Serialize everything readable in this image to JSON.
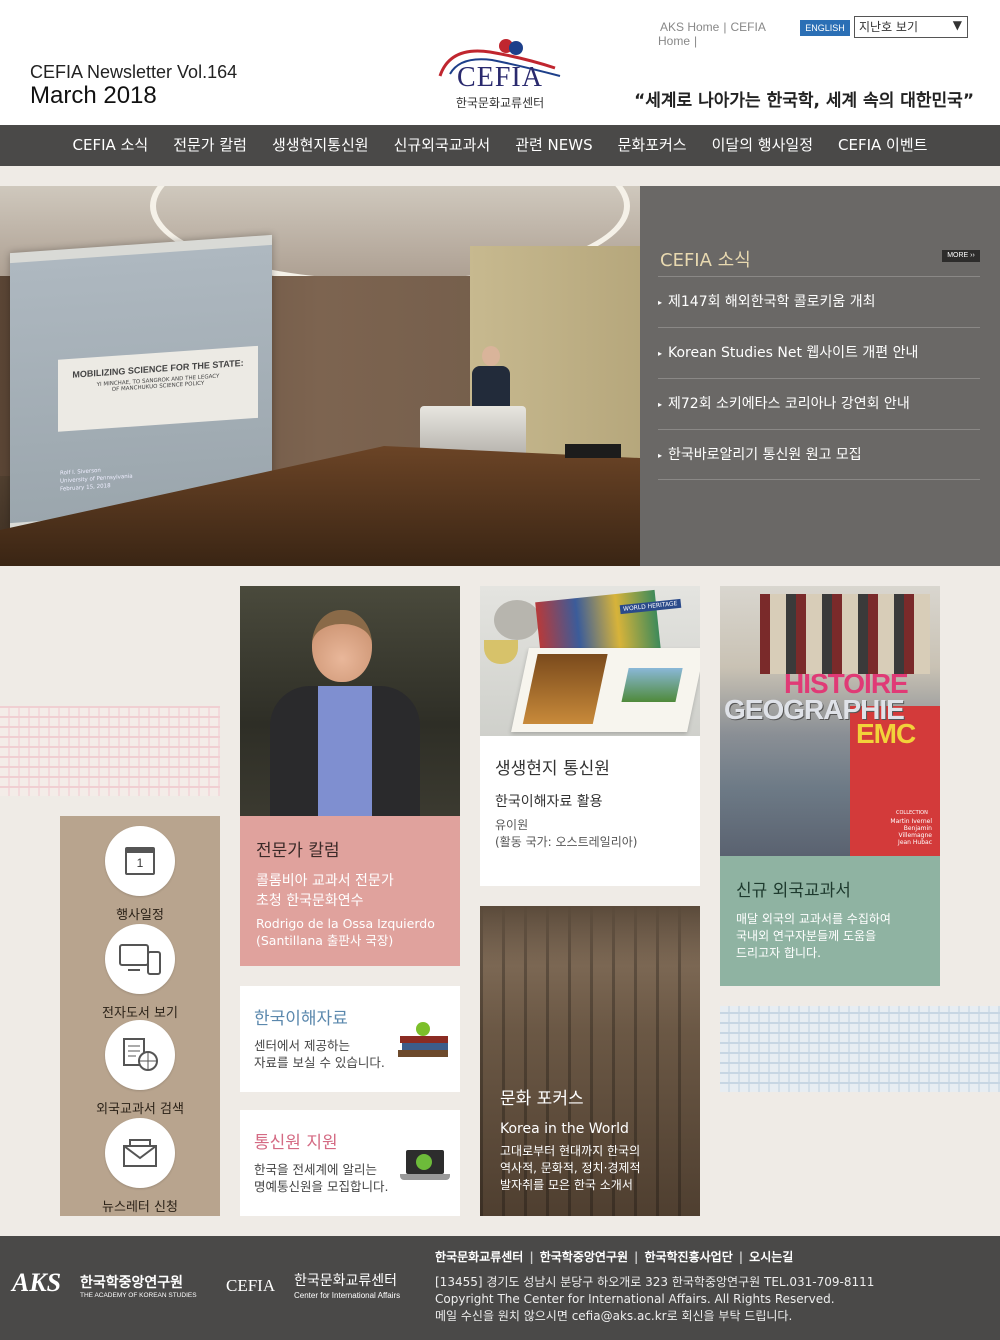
{
  "header": {
    "volume": "CEFIA Newsletter Vol.164",
    "issue_date": "March 2018",
    "top_links": [
      "AKS Home",
      "|",
      "CEFIA Home",
      "|"
    ],
    "english_button": "ENGLISH",
    "back_issue_select": "지난호 보기",
    "logo_text": "CEFIA",
    "logo_subtitle": "한국문화교류센터",
    "slogan": "“세계로 나아가는 한국학, 세계 속의 대한민국”"
  },
  "nav": {
    "items": [
      "CEFIA 소식",
      "전문가 칼럼",
      "생생현지통신원",
      "신규외국교과서",
      "관련 NEWS",
      "문화포커스",
      "이달의 행사일정",
      "CEFIA 이벤트"
    ]
  },
  "hero": {
    "slide_title": "MOBILIZING SCIENCE FOR THE STATE:",
    "slide_subtitle_1": "YI MINCHAE, TO SANGROK AND THE LEGACY",
    "slide_subtitle_2": "OF MANCHUKUO SCIENCE POLICY",
    "slide_author": "Rolf I. Siverson",
    "slide_univ": "University of Pennsylvania",
    "slide_date": "February 15, 2018",
    "news_title": "CEFIA 소식",
    "more_label": "MORE",
    "news_items": [
      "제147회 해외한국학 콜로키움 개최",
      "Korean Studies Net 웹사이트 개편 안내",
      "제72회 소키에타스 코리아나 강연회 안내",
      "한국바로알리기 통신원 원고 모집"
    ]
  },
  "quick_links": [
    "행사일정",
    "전자도서 보기",
    "외국교과서 검색",
    "뉴스레터 신청"
  ],
  "calendar_day": "1",
  "column_card": {
    "title": "전문가 칼럼",
    "headline_1": "콜롬비아 교과서 전문가",
    "headline_2": "초청 한국문화연수",
    "name": "Rodrigo de la Ossa Izquierdo",
    "role": "(Santillana 출판사 국장)"
  },
  "correspondent_card": {
    "title": "생생현지 통신원",
    "subtitle": "한국이해자료 활용",
    "name": "유이원",
    "country": "(활동 국가: 오스트레일리아)",
    "book_title": "WORLD HERITAGE"
  },
  "textbook_card": {
    "cover_line_1": "HISTOIRE",
    "cover_line_2": "GEOGRAPHIE",
    "cover_line_3": "EMC",
    "cover_collection": "COLLECTION",
    "cover_authors": [
      "Martin Ivernel",
      "Benjamin Villemagne",
      "Jean Hubac"
    ],
    "title": "신규 외국교과서",
    "text_1": "매달 외국의 교과서를 수집하여",
    "text_2": "국내외 연구자분들께 도움을",
    "text_3": "드리고자 합니다."
  },
  "resources_card": {
    "title": "한국이해자료",
    "text_1": "센터에서 제공하는",
    "text_2": "자료를 보실 수 있습니다."
  },
  "support_card": {
    "title": "통신원 지원",
    "text_1": "한국을 전세계에 알리는",
    "text_2": "명예통신원을 모집합니다."
  },
  "culture_card": {
    "title": "문화 포커스",
    "subtitle": "Korea in the World",
    "text_1": "고대로부터 현대까지 한국의",
    "text_2": "역사적, 문화적, 정치·경제적",
    "text_3": "발자취를 모은 한국 소개서"
  },
  "footer": {
    "links": [
      "한국문화교류센터",
      "한국학중앙연구원",
      "한국학진흥사업단",
      "오시는길"
    ],
    "aks_name": "한국학중앙연구원",
    "aks_english": "THE ACADEMY OF KOREAN STUDIES",
    "aks_mark": "AKS",
    "cefia_name": "한국문화교류센터",
    "cefia_english": "Center for International Affairs",
    "cefia_mark": "CEFIA",
    "address": "[13455] 경기도 성남시 분당구 하오개로 323 한국학중앙연구원 TEL.031-709-8111",
    "copyright": "Copyright The Center for International Affairs. All Rights Reserved.",
    "unsubscribe": "메일 수신을 원치 않으시면 cefia@aks.ac.kr로 회신을 부탁 드립니다."
  },
  "colors": {
    "nav_bg": "#4a4948",
    "news_panel_bg": "#6a6866",
    "column_card_bg": "#e0a29d",
    "textbook_card_bg": "#8fb3a2",
    "quick_links_bg": "#b8a48e",
    "resources_title": "#5b88ad",
    "support_title": "#d46a83",
    "english_button": "#2b6fb5"
  }
}
